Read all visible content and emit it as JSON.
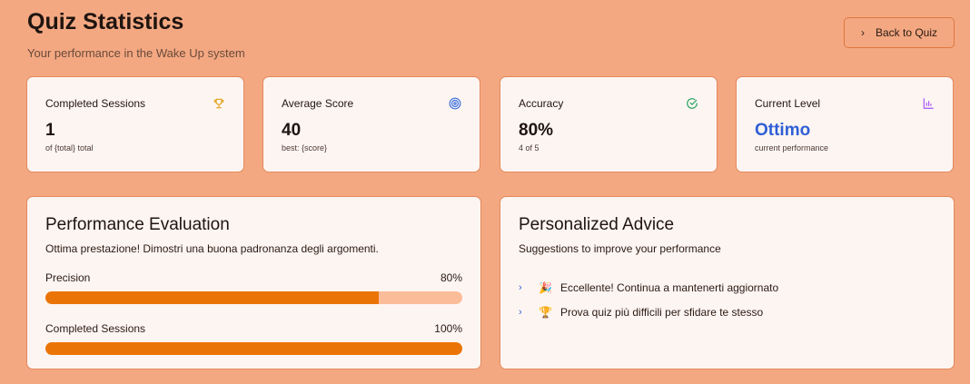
{
  "header": {
    "title": "Quiz Statistics",
    "subtitle": "Your performance in the Wake Up system",
    "back_label": "Back to Quiz"
  },
  "stats": [
    {
      "label": "Completed Sessions",
      "value": "1",
      "sub": "of {total} total",
      "icon": "trophy-icon"
    },
    {
      "label": "Average Score",
      "value": "40",
      "sub": "best: {score}",
      "icon": "target-icon"
    },
    {
      "label": "Accuracy",
      "value": "80%",
      "sub": "4 of 5",
      "icon": "check-circle-icon"
    },
    {
      "label": "Current Level",
      "value": "Ottimo",
      "sub": "current performance",
      "icon": "bar-chart-icon"
    }
  ],
  "evaluation": {
    "title": "Performance Evaluation",
    "description": "Ottima prestazione! Dimostri una buona padronanza degli argomenti.",
    "metrics": [
      {
        "label": "Precision",
        "value_text": "80%",
        "progress": 0.8
      },
      {
        "label": "Completed Sessions",
        "value_text": "100%",
        "progress": 1.0
      }
    ]
  },
  "advice": {
    "title": "Personalized Advice",
    "subtitle": "Suggestions to improve your performance",
    "items": [
      {
        "emoji": "🎉",
        "text": "Eccellente! Continua a mantenerti aggiornato"
      },
      {
        "emoji": "🏆",
        "text": "Prova quiz più difficili per sfidare te stesso"
      }
    ]
  },
  "colors": {
    "background": "#f3a882",
    "card": "#fdf5f2",
    "accent": "#eb7406",
    "level": "#2f5fd6",
    "trophy": "#e3a21a",
    "target": "#3b6fe0",
    "check": "#22a05a",
    "chart": "#a855f7"
  }
}
